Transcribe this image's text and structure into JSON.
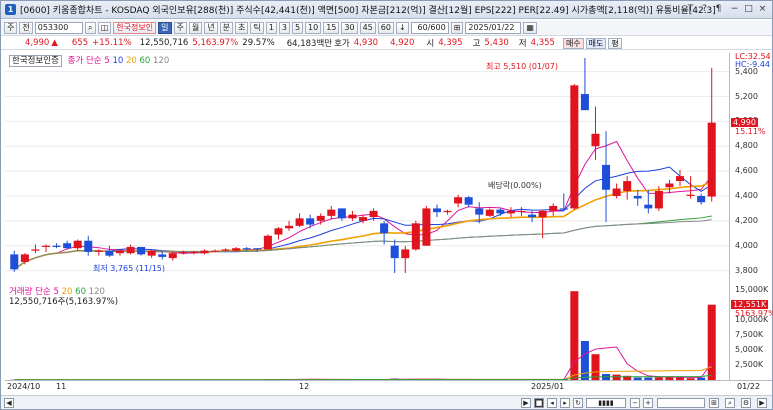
{
  "window": {
    "number": "1",
    "title": "[0600] 키움종합차트 - KOSDAQ 외국인보유[288(천)] 주식수[42,441(천)] 액면[500] 자본금[212(억)] 결산[12월] EPS[222] PER[22.49] 시가총액[2,118(억)] 유통비율[42.3]",
    "buttons": [
      "T",
      "?",
      "¶",
      "−",
      "□",
      "×"
    ]
  },
  "toolbar": {
    "mode": "주",
    "nav": "전",
    "code": "053300",
    "stock_name": "한국정보인",
    "period_buttons": [
      "일",
      "주",
      "월",
      "년",
      "분",
      "초",
      "틱"
    ],
    "interval_buttons": [
      "1",
      "3",
      "5",
      "10",
      "15",
      "30",
      "45",
      "60"
    ],
    "count": "60/600",
    "date": "2025/01/22"
  },
  "quote": {
    "price": "4,990",
    "arrow": "▲",
    "change": "655",
    "change_pct": "+15.11%",
    "volume": "12,550,716",
    "vol_pct": "5,163.97%",
    "turnover": "29.57%",
    "amount": "64,183백만",
    "hoga_label": "호가",
    "ask": "4,930",
    "bid": "4,920",
    "open_label": "시",
    "open": "4,395",
    "high_label": "고",
    "high": "5,430",
    "low_label": "저",
    "low": "4,355",
    "buy": "매수",
    "sell": "매도",
    "avg": "평"
  },
  "price_pane": {
    "name": "한국정보인증",
    "ma_label": "종가 단순",
    "ma_periods": [
      "5",
      "10",
      "20",
      "60",
      "120"
    ],
    "ma_colors": [
      "#e0149c",
      "#1e3ee0",
      "#f0a000",
      "#2aa03a",
      "#888888"
    ],
    "high_note": "최고 5,510 (01/07)",
    "low_note": "최저 3,765 (11/15)",
    "dividend_note": "배당락(0.00%)",
    "y_ticks": [
      "5,400",
      "5,200",
      "5,000",
      "4,800",
      "4,600",
      "4,400",
      "4,200",
      "4,000",
      "3,800"
    ],
    "lc": "LC:32.54",
    "hc": "HC:-9.44",
    "price_tag": "4,990",
    "pct_tag": "15.11%"
  },
  "vol_pane": {
    "ma_label": "거래량 단순",
    "ma_periods": [
      "5",
      "20",
      "60",
      "120"
    ],
    "info": "12,550,716주(5,163.97%)",
    "y_ticks": [
      "15,000K",
      "12,500K",
      "10,000K",
      "7,500K",
      "5,000K",
      "2,500K"
    ],
    "vol_tag": "12,551K",
    "vol_pct_tag": "5163.97%"
  },
  "x_axis": {
    "labels": [
      "2024/10",
      "11",
      "12",
      "2025/01"
    ],
    "right": "01/22"
  },
  "chart_data": {
    "type": "candlestick",
    "candles": [
      [
        3930,
        3960,
        3790,
        3810
      ],
      [
        3870,
        3940,
        3850,
        3930
      ],
      [
        3960,
        4010,
        3940,
        3970
      ],
      [
        3990,
        4010,
        3950,
        4000
      ],
      [
        4000,
        4020,
        3980,
        3990
      ],
      [
        4020,
        4040,
        3970,
        3980
      ],
      [
        3980,
        4050,
        3960,
        4040
      ],
      [
        4040,
        4080,
        3920,
        3950
      ],
      [
        3950,
        3970,
        3920,
        3960
      ],
      [
        3960,
        4000,
        3910,
        3920
      ],
      [
        3940,
        3970,
        3920,
        3960
      ],
      [
        3940,
        4010,
        3930,
        3990
      ],
      [
        3990,
        3990,
        3920,
        3930
      ],
      [
        3920,
        3970,
        3900,
        3960
      ],
      [
        3930,
        3960,
        3890,
        3910
      ],
      [
        3900,
        3950,
        3880,
        3940
      ],
      [
        3940,
        3960,
        3930,
        3950
      ],
      [
        3940,
        3960,
        3930,
        3950
      ],
      [
        3940,
        3970,
        3930,
        3960
      ],
      [
        3960,
        3970,
        3950,
        3960
      ],
      [
        3960,
        3980,
        3950,
        3970
      ],
      [
        3960,
        3990,
        3950,
        3980
      ],
      [
        3980,
        3990,
        3960,
        3970
      ],
      [
        3980,
        3980,
        3950,
        3970
      ],
      [
        3970,
        4090,
        3970,
        4080
      ],
      [
        4090,
        4150,
        4050,
        4140
      ],
      [
        4140,
        4200,
        4120,
        4160
      ],
      [
        4160,
        4260,
        4150,
        4220
      ],
      [
        4220,
        4250,
        4140,
        4170
      ],
      [
        4200,
        4260,
        4170,
        4240
      ],
      [
        4240,
        4320,
        4210,
        4290
      ],
      [
        4300,
        4300,
        4200,
        4220
      ],
      [
        4220,
        4280,
        4200,
        4250
      ],
      [
        4200,
        4250,
        4180,
        4230
      ],
      [
        4230,
        4300,
        4200,
        4280
      ],
      [
        4180,
        4200,
        4010,
        4100
      ],
      [
        4000,
        4050,
        3780,
        3900
      ],
      [
        3900,
        4000,
        3780,
        3970
      ],
      [
        3970,
        4200,
        3960,
        4180
      ],
      [
        4000,
        4320,
        4000,
        4300
      ],
      [
        4300,
        4330,
        4230,
        4270
      ],
      [
        4270,
        4290,
        4250,
        4280
      ],
      [
        4340,
        4410,
        4310,
        4390
      ],
      [
        4390,
        4400,
        4310,
        4330
      ],
      [
        4300,
        4350,
        4180,
        4250
      ],
      [
        4240,
        4300,
        4230,
        4290
      ],
      [
        4290,
        4300,
        4240,
        4260
      ],
      [
        4260,
        4310,
        4230,
        4280
      ],
      [
        4280,
        4310,
        4240,
        4280
      ],
      [
        4250,
        4280,
        4190,
        4230
      ],
      [
        4230,
        4290,
        4060,
        4280
      ],
      [
        4280,
        4340,
        4240,
        4320
      ],
      [
        4300,
        4420,
        4280,
        4290
      ],
      [
        4300,
        5300,
        4290,
        5290
      ],
      [
        5220,
        5510,
        5200,
        5090
      ],
      [
        4800,
        5120,
        4690,
        4900
      ],
      [
        4650,
        4920,
        4190,
        4450
      ],
      [
        4400,
        4500,
        4380,
        4460
      ],
      [
        4440,
        4560,
        4370,
        4520
      ],
      [
        4400,
        4450,
        4320,
        4380
      ],
      [
        4330,
        4450,
        4260,
        4300
      ],
      [
        4300,
        4480,
        4280,
        4440
      ],
      [
        4470,
        4530,
        4420,
        4500
      ],
      [
        4520,
        4610,
        4480,
        4560
      ],
      [
        4400,
        4560,
        4380,
        4410
      ],
      [
        4400,
        4420,
        4330,
        4350
      ],
      [
        4395,
        5430,
        4355,
        4990
      ]
    ],
    "volumes": [
      40,
      30,
      35,
      30,
      25,
      30,
      35,
      90,
      40,
      35,
      30,
      30,
      45,
      40,
      40,
      35,
      30,
      25,
      30,
      25,
      25,
      30,
      30,
      30,
      120,
      150,
      130,
      120,
      90,
      100,
      110,
      80,
      70,
      60,
      90,
      130,
      250,
      80,
      140,
      180,
      90,
      80,
      80,
      70,
      70,
      60,
      60,
      70,
      70,
      60,
      90,
      80,
      100,
      14800,
      6500,
      4300,
      1000,
      900,
      700,
      400,
      400,
      450,
      500,
      500,
      300,
      400,
      12551
    ],
    "ylim": [
      3700,
      5550
    ],
    "vol_ylim": [
      0,
      16000
    ]
  }
}
